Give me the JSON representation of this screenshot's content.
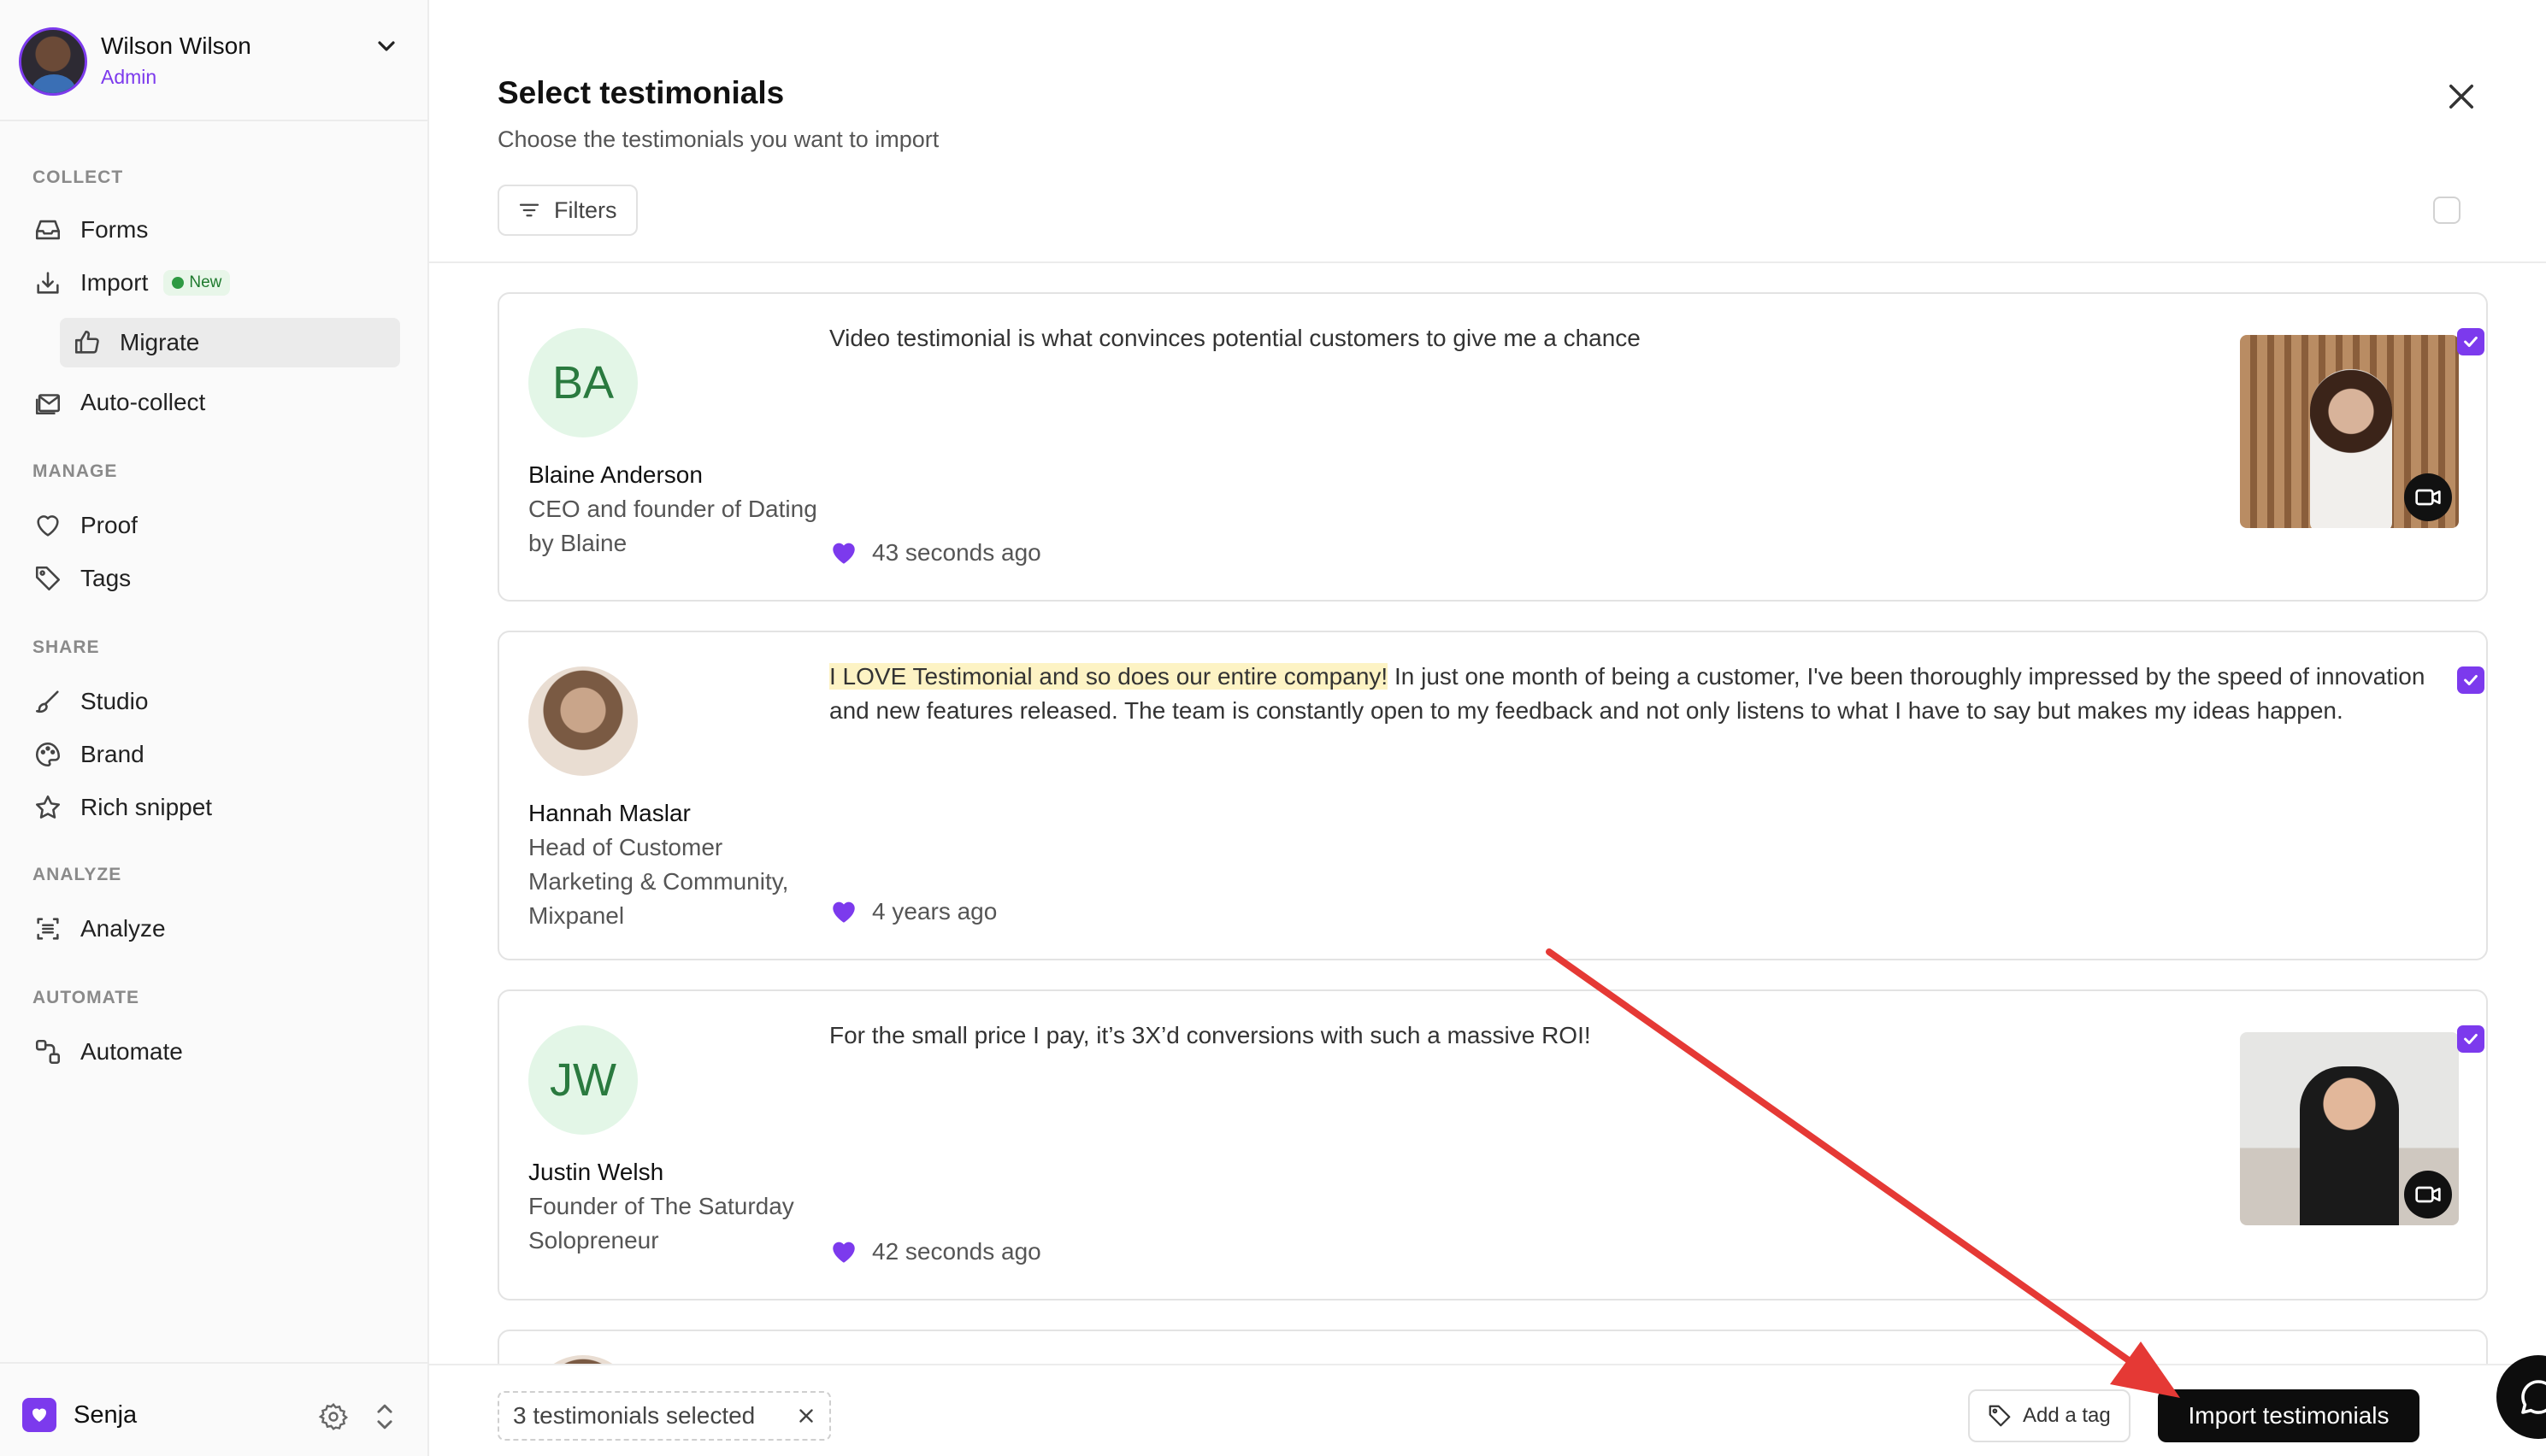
{
  "user": {
    "name": "Wilson Wilson",
    "role": "Admin"
  },
  "sidebar": {
    "sections": {
      "collect": "COLLECT",
      "manage": "MANAGE",
      "share": "SHARE",
      "analyze": "ANALYZE",
      "automate": "AUTOMATE"
    },
    "items": {
      "forms": "Forms",
      "import": "Import",
      "import_badge": "New",
      "migrate": "Migrate",
      "auto_collect": "Auto-collect",
      "proof": "Proof",
      "tags": "Tags",
      "studio": "Studio",
      "brand": "Brand",
      "rich_snippet": "Rich snippet",
      "analyze": "Analyze",
      "automate": "Automate"
    },
    "workspace": "Senja"
  },
  "dialog": {
    "title": "Select testimonials",
    "subtitle": "Choose the testimonials you want to import",
    "filters_label": "Filters"
  },
  "testimonials": [
    {
      "initials": "BA",
      "name": "Blaine Anderson",
      "role": "CEO and founder of Dating by Blaine",
      "text": "Video testimonial is what convinces potential customers to give me a chance",
      "time": "43 seconds ago",
      "has_video": true,
      "selected": true
    },
    {
      "initials": "",
      "name": "Hannah Maslar",
      "role": "Head of Customer Marketing & Community, Mixpanel",
      "highlight": "I LOVE Testimonial and so does our entire company!",
      "text": " In just one month of being a customer, I've been thoroughly impressed by the speed of innovation and new features released. The team is constantly open to my feedback and not only listens to what I have to say but makes my ideas happen.",
      "time": "4 years ago",
      "has_video": false,
      "selected": true
    },
    {
      "initials": "JW",
      "name": "Justin Welsh",
      "role": "Founder of The Saturday Solopreneur",
      "text": "For the small price I pay, it’s 3X’d conversions with such a massive ROI!",
      "time": "42 seconds ago",
      "has_video": true,
      "selected": true
    }
  ],
  "bottom_bar": {
    "selected_count": "3 testimonials selected",
    "add_tag": "Add a tag",
    "import_button": "Import testimonials"
  },
  "colors": {
    "accent": "#7c3aed",
    "primary_button": "#0d0d0d",
    "highlight": "#fdf3c4",
    "arrow": "#e53935"
  }
}
